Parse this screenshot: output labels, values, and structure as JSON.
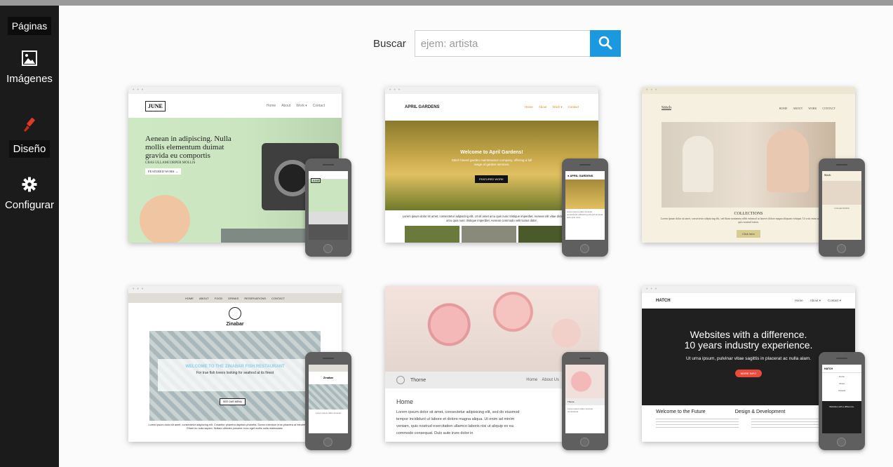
{
  "sidebar": {
    "items": [
      {
        "label": "Páginas",
        "icon": "pages"
      },
      {
        "label": "Imágenes",
        "icon": "image-icon"
      },
      {
        "label": "Diseño",
        "icon": "brush-icon"
      },
      {
        "label": "Configurar",
        "icon": "gear-icon"
      }
    ]
  },
  "search": {
    "label": "Buscar",
    "placeholder": "ejem: artista",
    "value": "",
    "button_color": "#1a98e0"
  },
  "templates": [
    {
      "brand": "JUNE",
      "nav": [
        "Home",
        "About",
        "Work ▾",
        "Contact"
      ],
      "headline": "Aenean in adipiscing. Nulla mollis elementum duimat gravida eu comportis",
      "sub": "CRAS ULLAMCORPER MOLLIS",
      "button": "FEATURED WORK →"
    },
    {
      "brand": "APRIL GARDENS",
      "nav": [
        "Home",
        "About",
        "Work ▾",
        "Contact"
      ],
      "headline": "Welcome to April Gardens!",
      "sub": "Stitch based garden maintenance company, offering a full range of garden services.",
      "button": "FEATURED WORK",
      "body": "Lorem ipsum dolor sit amet, consectetur adipiscing elit. Ut sit amet arcu quis nunc tristique imperdiet. Aenean elit vitae dictum. Ut sit amet arcu quis nunc tristique imperdiet. Aenean commodo velit luctus dolor."
    },
    {
      "brand": "Stitch",
      "nav": [
        "HOME",
        "ABOUT",
        "WORK",
        "CONTACT"
      ],
      "headline": "COLLECTIONS",
      "sub": "Lorem ipsum dolor sit amet, consectetur adipiscing elit, sed diam nonummy nibh euismod ut laoreet dolore magna aliquam volutpat. Ut wisi enim ad minim veniam, quis nostrud tation.",
      "button": "Click here"
    },
    {
      "brand": "Zinabar",
      "nav": [
        "HOME",
        "ABOUT",
        "FOOD",
        "DRINKS",
        "RESERVATIONS",
        "CONTACT"
      ],
      "headline": "WELCOME TO THE ZINABAR FISH RESTAURANT",
      "sub": "For true fish lovers looking for seafood at its finest",
      "button": "SEE OUR MENU",
      "body": "Lorem ipsum dolor sit amet, consectetur adipiscing elit. Curabitur pharetra dapibus pharetra. Donec interdum eros pharetra at hendrerit sed ornare. Etiam eu nulla sapien. Nullam ultricies posuere nunc eget mollis nulla malesuada."
    },
    {
      "brand": "Thorne",
      "nav": [
        "Home",
        "About Us"
      ],
      "headline": "Home",
      "body": "Lorem ipsum dolor sit amet, consectetur adipisicing elit, sed do eiusmod tempor incididunt ut labore et dolore magna aliqua. Ut enim ad minim veniam, quis nostrud exercitation ullamco laboris nisi ut aliquip ex ea commodo consequat. Duis aute irure dolor in"
    },
    {
      "brand": "HATCH",
      "nav": [
        "Home",
        "About ▾",
        "Contact ▾"
      ],
      "headline1": "Websites with a difference.",
      "headline2": "10 years industry experience.",
      "sub": "Ut urna ipsum, pulvinar vitae sagittis in placerat ac nulla alam.",
      "button": "MORE INFO",
      "col1": "Welcome to the Future",
      "col2": "Design & Development"
    }
  ]
}
